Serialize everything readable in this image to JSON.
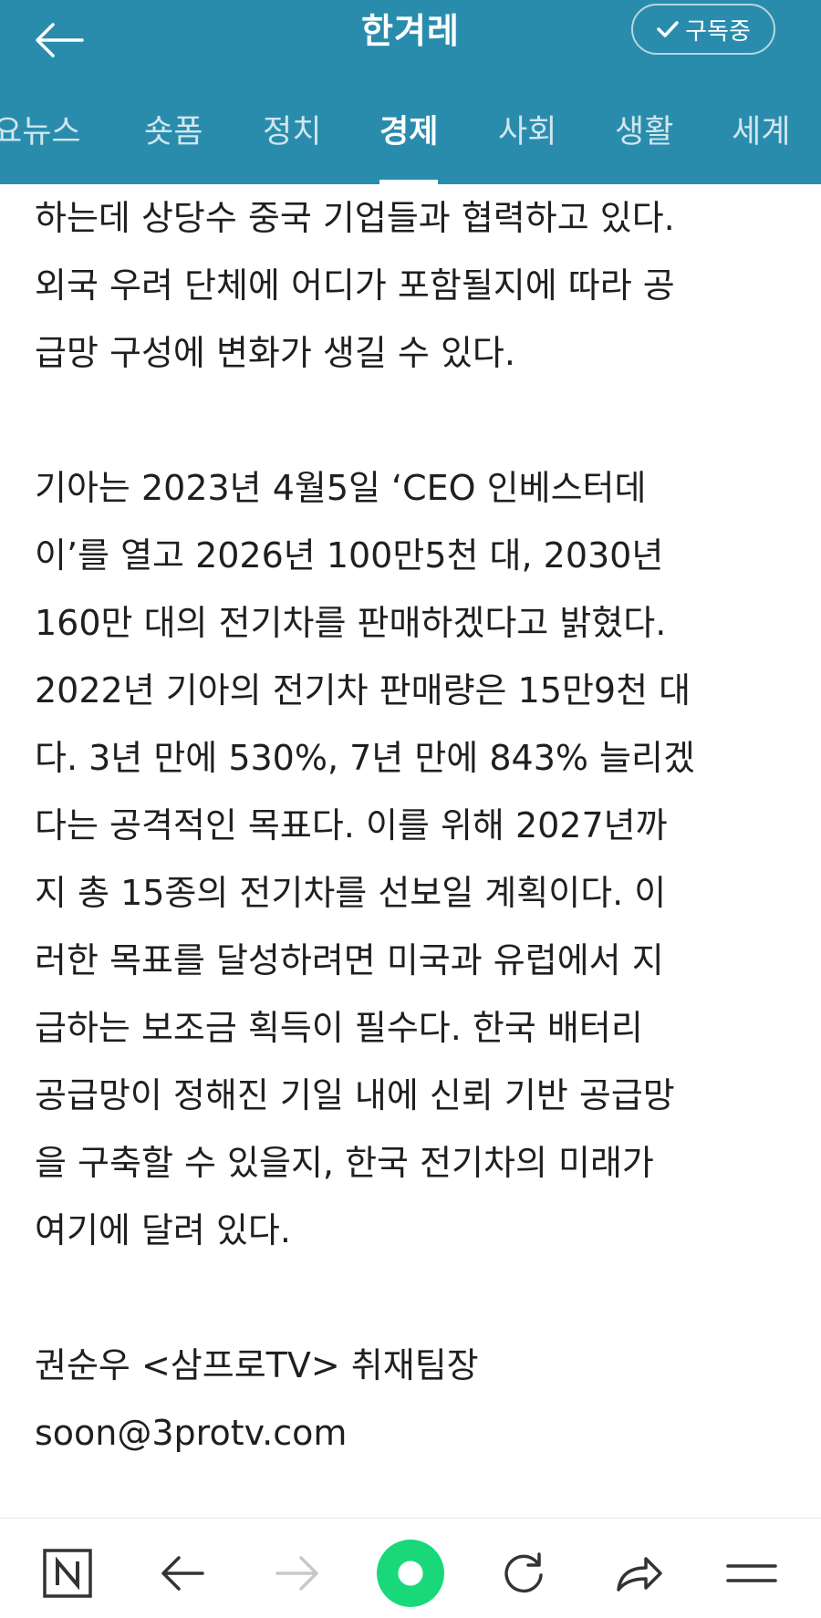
{
  "header": {
    "title": "한겨레",
    "subscribe_label": "구독중"
  },
  "tabs": [
    {
      "label": "요뉴스",
      "active": false
    },
    {
      "label": "숏폼",
      "active": false
    },
    {
      "label": "정치",
      "active": false
    },
    {
      "label": "경제",
      "active": true
    },
    {
      "label": "사회",
      "active": false
    },
    {
      "label": "생활",
      "active": false
    },
    {
      "label": "세계",
      "active": false
    }
  ],
  "article": {
    "paragraphs": [
      "하는데 상당수 중국 기업들과 협력하고 있다.\n외국 우려 단체에 어디가 포함될지에 따라 공\n급망 구성에 변화가 생길 수 있다.",
      "기아는 2023년 4월5일 ‘CEO 인베스터데\n이’를 열고 2026년 100만5천 대, 2030년\n160만 대의 전기차를 판매하겠다고 밝혔다.\n2022년 기아의 전기차 판매량은 15만9천 대\n다. 3년 만에 530%, 7년 만에 843% 늘리겠\n다는 공격적인 목표다. 이를 위해 2027년까\n지 총 15종의 전기차를 선보일 계획이다. 이\n러한 목표를 달성하려면 미국과 유럽에서 지\n급하는 보조금 획득이 필수다. 한국 배터리\n공급망이 정해진 기일 내에 신뢰 기반 공급망\n을 구축할 수 있을지, 한국 전기차의 미래가\n여기에 달려 있다."
    ],
    "author": "권순우 <삼프로TV> 취재팀장",
    "email": "soon@3protv.com"
  },
  "colors": {
    "brand": "#2a8cad",
    "accent_green": "#19d879"
  },
  "bottom_nav": {
    "icons": [
      "naver-n-icon",
      "back-arrow-icon",
      "forward-arrow-icon",
      "green-dot-icon",
      "refresh-icon",
      "share-icon",
      "menu-icon"
    ]
  }
}
